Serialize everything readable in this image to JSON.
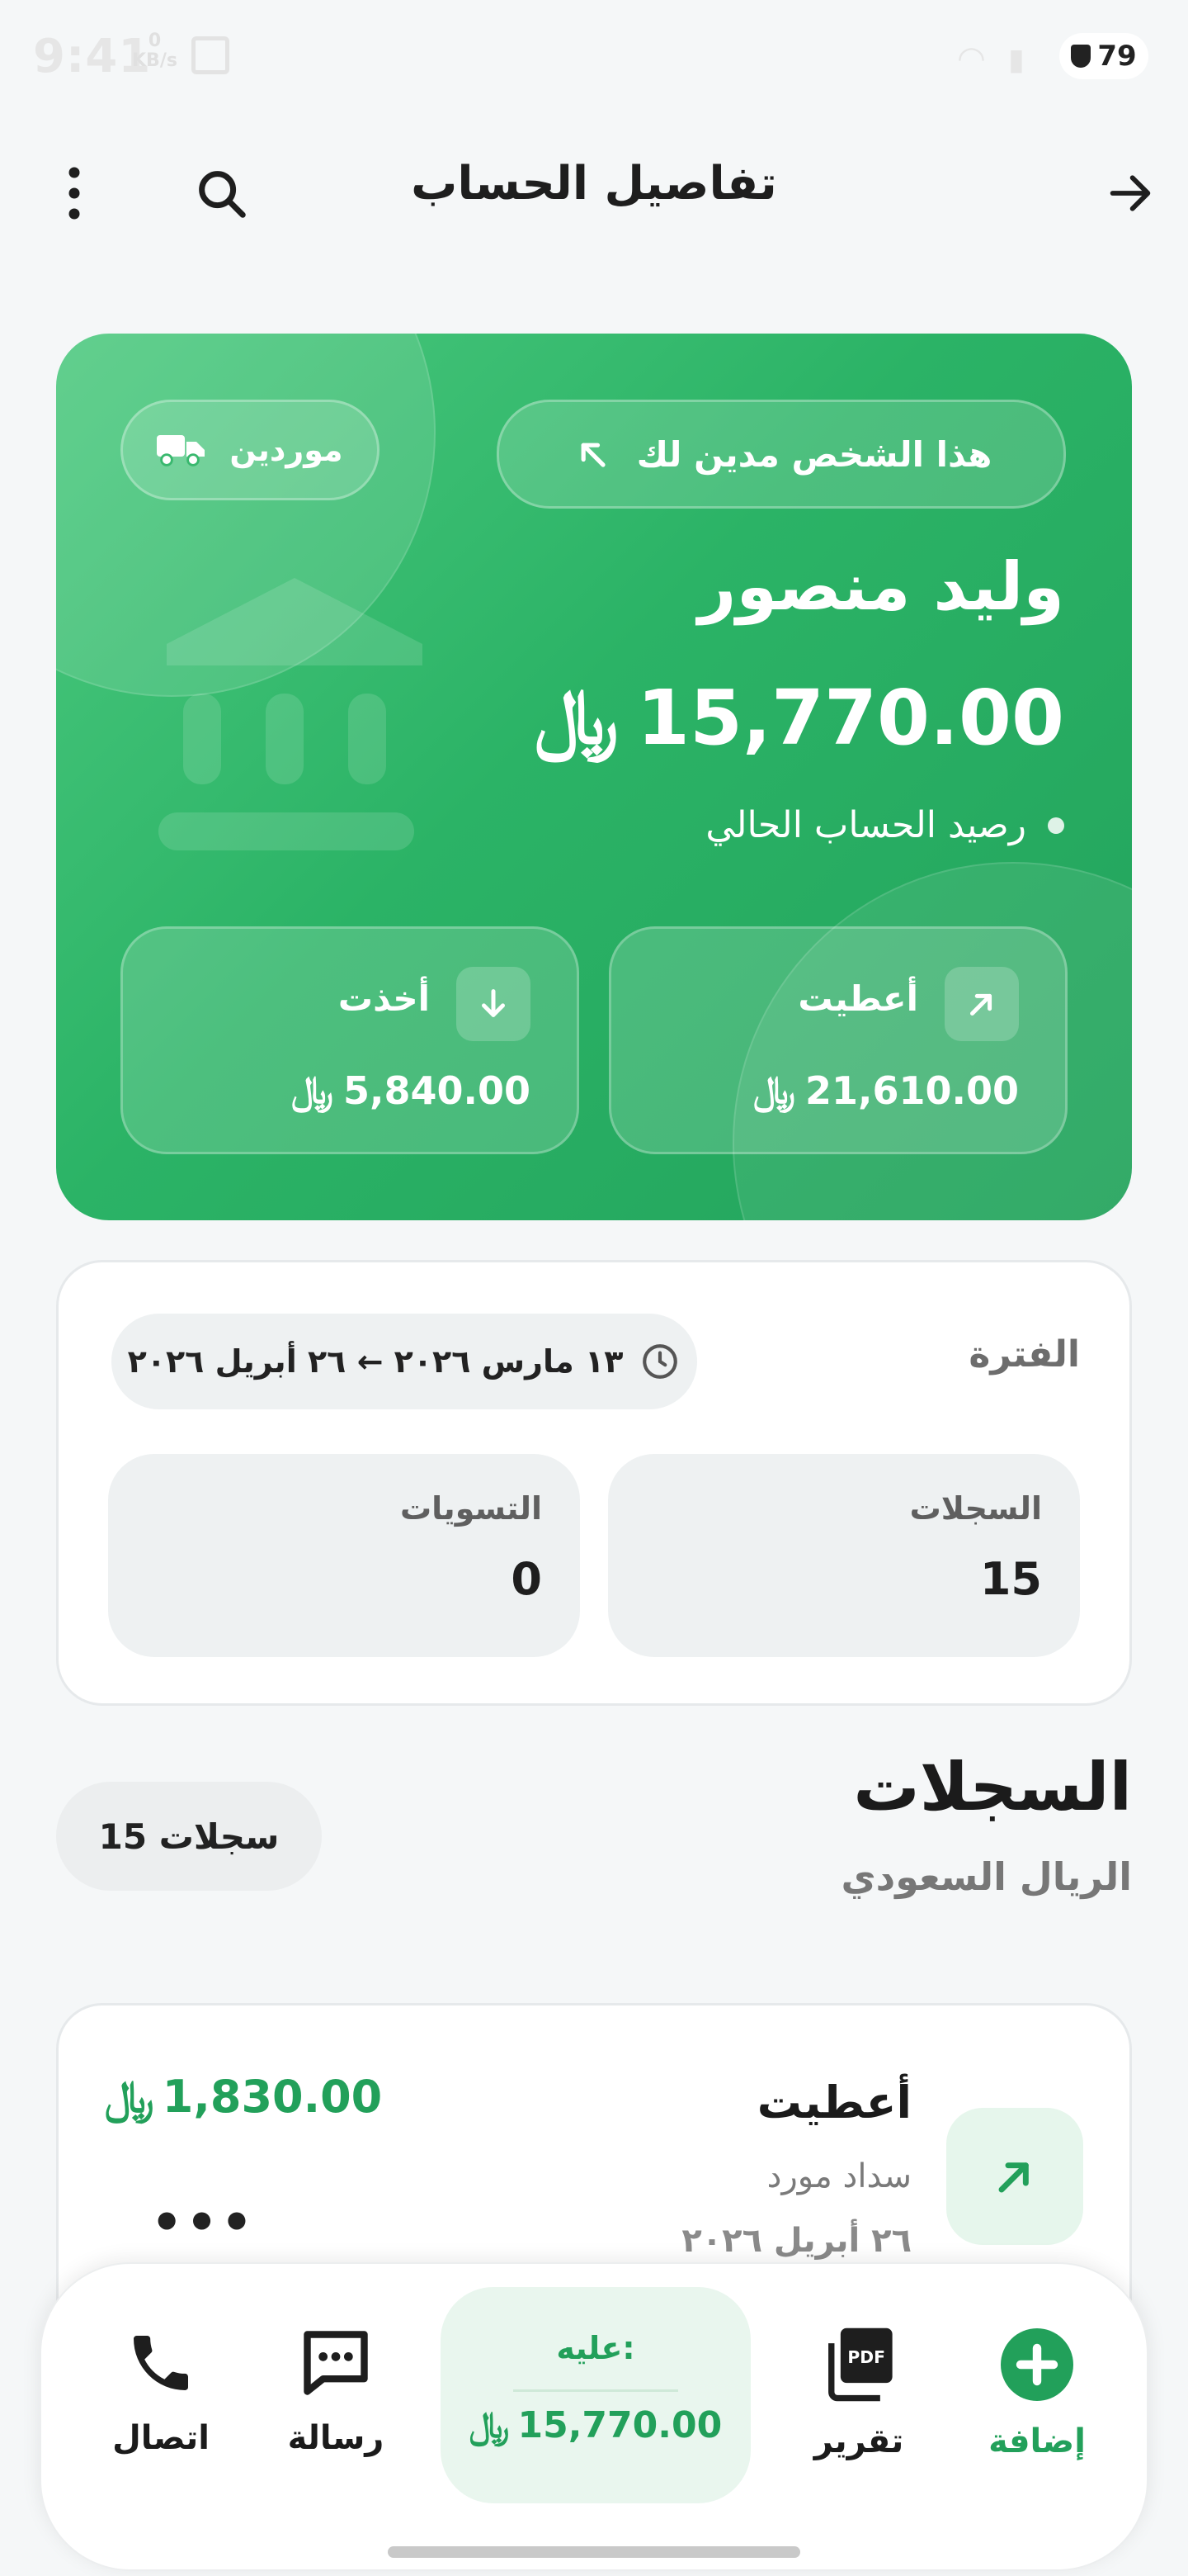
{
  "status": {
    "time": "9:41",
    "speed_value": "0",
    "speed_unit": "KB/s",
    "battery": "79"
  },
  "appbar": {
    "title": "تفاصيل الحساب"
  },
  "hero": {
    "debt_badge": "هذا الشخص مدين لك",
    "category_badge": "موردين",
    "name": "وليد منصور",
    "balance": "15,770.00",
    "currency_symbol": "﷼",
    "balance_label": "رصيد الحساب الحالي",
    "given_label": "أعطيت",
    "given_amount": "21,610.00",
    "taken_label": "أخذت",
    "taken_amount": "5,840.00"
  },
  "period": {
    "label": "الفترة",
    "range": "١٣ مارس ٢٠٢٦ ← ٢٦ أبريل ٢٠٢٦",
    "records_label": "السجلات",
    "records_value": "15",
    "settlements_label": "التسويات",
    "settlements_value": "0"
  },
  "records": {
    "title": "السجلات",
    "currency": "الريال السعودي",
    "count_badge": "15 سجلات",
    "items": [
      {
        "type": "أعطيت",
        "description": "سداد مورد",
        "date": "٢٦ أبريل ٢٠٢٦",
        "amount": "1,830.00",
        "more": "•••"
      }
    ]
  },
  "bottom_nav": {
    "add": "إضافة",
    "report": "تقرير",
    "balance_label": "عليه:",
    "balance_amount": "15,770.00",
    "message": "رسالة",
    "call": "اتصال"
  },
  "colors": {
    "primary_green": "#2bb366",
    "text_green": "#22a05a",
    "background": "#f5f7f8"
  },
  "icons": [
    "arrow-right-icon",
    "search-icon",
    "more-vertical-icon",
    "truck-icon",
    "arrow-up-left-icon",
    "arrow-down-icon",
    "arrow-up-right-icon",
    "clock-icon",
    "plus-circle-icon",
    "pdf-icon",
    "message-icon",
    "phone-icon"
  ]
}
